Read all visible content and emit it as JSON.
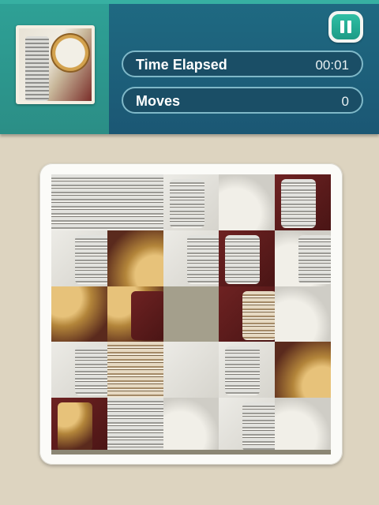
{
  "header": {
    "time_label": "Time Elapsed",
    "time_value": "00:01",
    "moves_label": "Moves",
    "moves_value": "0"
  },
  "icons": {
    "pause": "pause-icon"
  },
  "colors": {
    "teal": "#2c8f86",
    "navy": "#1e5b77",
    "button_green": "#1d9b86",
    "background": "#ddd4c0"
  },
  "puzzle": {
    "grid_size": "5x5",
    "empty_position": {
      "row": 3,
      "col": 3
    }
  }
}
